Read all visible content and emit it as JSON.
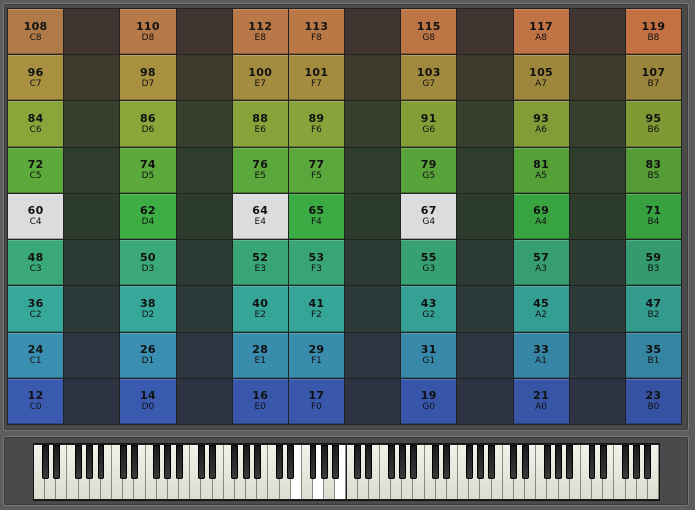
{
  "colors": {
    "lit_key": "#dcdcdc",
    "empty_cell": "#3c3c3c"
  },
  "grid": {
    "lit_notes": [
      60,
      64,
      67
    ],
    "rows": [
      [
        {
          "num": "108",
          "name": "C8"
        },
        null,
        {
          "num": "110",
          "name": "D8"
        },
        null,
        {
          "num": "112",
          "name": "E8"
        },
        {
          "num": "113",
          "name": "F8"
        },
        null,
        {
          "num": "115",
          "name": "G8"
        },
        null,
        {
          "num": "117",
          "name": "A8"
        },
        null,
        {
          "num": "119",
          "name": "B8"
        }
      ],
      [
        {
          "num": "96",
          "name": "C7"
        },
        null,
        {
          "num": "98",
          "name": "D7"
        },
        null,
        {
          "num": "100",
          "name": "E7"
        },
        {
          "num": "101",
          "name": "F7"
        },
        null,
        {
          "num": "103",
          "name": "G7"
        },
        null,
        {
          "num": "105",
          "name": "A7"
        },
        null,
        {
          "num": "107",
          "name": "B7"
        }
      ],
      [
        {
          "num": "84",
          "name": "C6"
        },
        null,
        {
          "num": "86",
          "name": "D6"
        },
        null,
        {
          "num": "88",
          "name": "E6"
        },
        {
          "num": "89",
          "name": "F6"
        },
        null,
        {
          "num": "91",
          "name": "G6"
        },
        null,
        {
          "num": "93",
          "name": "A6"
        },
        null,
        {
          "num": "95",
          "name": "B6"
        }
      ],
      [
        {
          "num": "72",
          "name": "C5"
        },
        null,
        {
          "num": "74",
          "name": "D5"
        },
        null,
        {
          "num": "76",
          "name": "E5"
        },
        {
          "num": "77",
          "name": "F5"
        },
        null,
        {
          "num": "79",
          "name": "G5"
        },
        null,
        {
          "num": "81",
          "name": "A5"
        },
        null,
        {
          "num": "83",
          "name": "B5"
        }
      ],
      [
        {
          "num": "60",
          "name": "C4"
        },
        null,
        {
          "num": "62",
          "name": "D4"
        },
        null,
        {
          "num": "64",
          "name": "E4"
        },
        {
          "num": "65",
          "name": "F4"
        },
        null,
        {
          "num": "67",
          "name": "G4"
        },
        null,
        {
          "num": "69",
          "name": "A4"
        },
        null,
        {
          "num": "71",
          "name": "B4"
        }
      ],
      [
        {
          "num": "48",
          "name": "C3"
        },
        null,
        {
          "num": "50",
          "name": "D3"
        },
        null,
        {
          "num": "52",
          "name": "E3"
        },
        {
          "num": "53",
          "name": "F3"
        },
        null,
        {
          "num": "55",
          "name": "G3"
        },
        null,
        {
          "num": "57",
          "name": "A3"
        },
        null,
        {
          "num": "59",
          "name": "B3"
        }
      ],
      [
        {
          "num": "36",
          "name": "C2"
        },
        null,
        {
          "num": "38",
          "name": "D2"
        },
        null,
        {
          "num": "40",
          "name": "E2"
        },
        {
          "num": "41",
          "name": "F2"
        },
        null,
        {
          "num": "43",
          "name": "G2"
        },
        null,
        {
          "num": "45",
          "name": "A2"
        },
        null,
        {
          "num": "47",
          "name": "B2"
        }
      ],
      [
        {
          "num": "24",
          "name": "C1"
        },
        null,
        {
          "num": "26",
          "name": "D1"
        },
        null,
        {
          "num": "28",
          "name": "E1"
        },
        {
          "num": "29",
          "name": "F1"
        },
        null,
        {
          "num": "31",
          "name": "G1"
        },
        null,
        {
          "num": "33",
          "name": "A1"
        },
        null,
        {
          "num": "35",
          "name": "B1"
        }
      ],
      [
        {
          "num": "12",
          "name": "C0"
        },
        null,
        {
          "num": "14",
          "name": "D0"
        },
        null,
        {
          "num": "16",
          "name": "E0"
        },
        {
          "num": "17",
          "name": "F0"
        },
        null,
        {
          "num": "19",
          "name": "G0"
        },
        null,
        {
          "num": "21",
          "name": "A0"
        },
        null,
        {
          "num": "23",
          "name": "B0"
        }
      ]
    ]
  },
  "keyboard": {
    "white_key_count": 56,
    "pressed_white_keys": [
      23,
      25,
      27
    ]
  }
}
